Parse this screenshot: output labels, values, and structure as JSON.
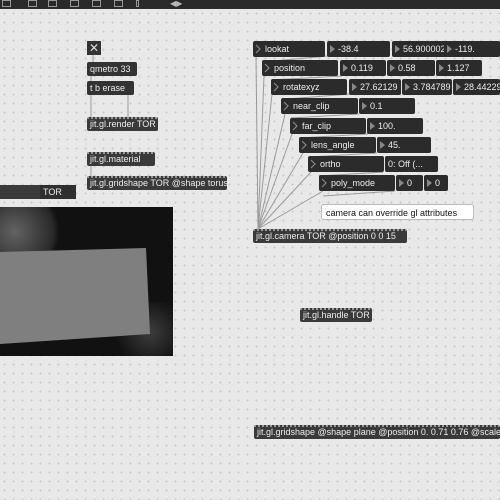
{
  "toolbar": {
    "icons": [
      "lock-icon",
      "grid-icon",
      "object-icon",
      "message-icon",
      "number-icon",
      "comment-icon",
      "info-icon"
    ]
  },
  "toggle": {
    "glyph": "✕"
  },
  "objects": {
    "qmetro": "qmetro 33",
    "tb_erase": "t b erase",
    "render": "jit.gl.render TOR",
    "material": "jit.gl.material",
    "gridshape_torus": "jit.gl.gridshape TOR @shape torus",
    "camera": "jit.gl.camera TOR @position 0 0 15",
    "handle": "jit.gl.handle TOR",
    "gridshape_plane": "jit.gl.gridshape @shape plane @position 0. 0.71 0.76 @scale"
  },
  "messages": {
    "lookat": "lookat",
    "position": "position",
    "rotatexyz": "rotatexyz",
    "near_clip": "near_clip",
    "far_clip": "far_clip",
    "lens_angle": "lens_angle",
    "ortho": "ortho",
    "poly_mode": "poly_mode"
  },
  "numbers": {
    "lookat": [
      "-38.4",
      "56.900002",
      "-119."
    ],
    "position": [
      "0.119",
      "0.58",
      "1.127"
    ],
    "rotatexyz": [
      "27.62129",
      "3.784789",
      "28.442291"
    ],
    "near_clip": "0.1",
    "far_clip": "100.",
    "lens_angle": "45.",
    "ortho": "0: Off (...",
    "poly_mode": [
      "0",
      "0"
    ]
  },
  "comment": "camera can override gl attributes",
  "window": {
    "label": "TOR"
  },
  "colors": {
    "object_bg": "#333333",
    "canvas_bg": "#e8e8e8",
    "wire": "#9a9a9a"
  }
}
